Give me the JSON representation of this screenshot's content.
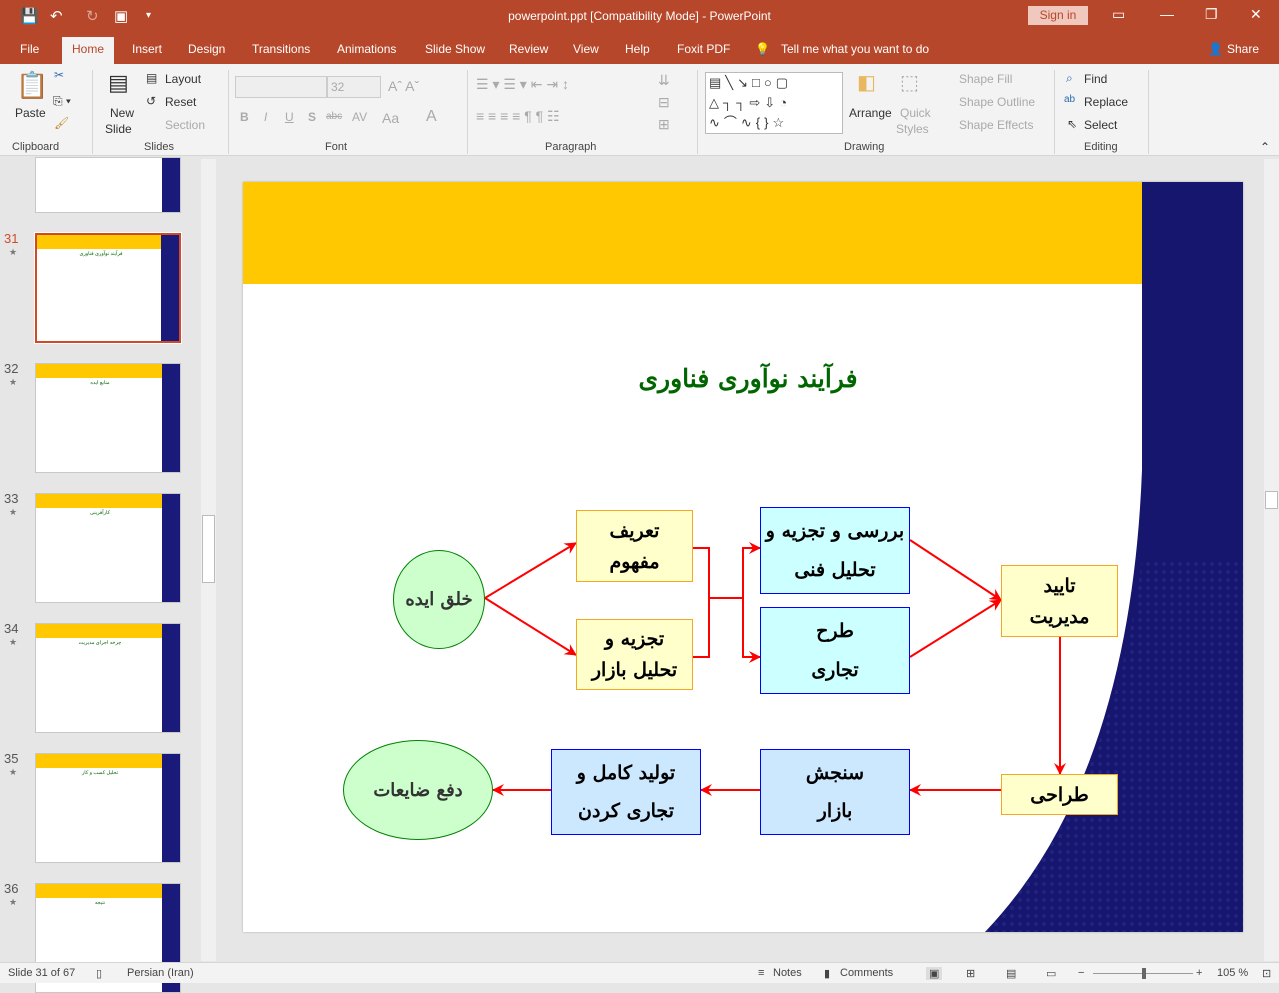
{
  "window": {
    "title": "powerpoint.ppt [Compatibility Mode]  -  PowerPoint",
    "sign_in": "Sign in"
  },
  "tabs": [
    "File",
    "Home",
    "Insert",
    "Design",
    "Transitions",
    "Animations",
    "Slide Show",
    "Review",
    "View",
    "Help",
    "Foxit PDF"
  ],
  "tell_me": "Tell me what you want to do",
  "share": "Share",
  "ribbon": {
    "clipboard": {
      "paste": "Paste",
      "label": "Clipboard"
    },
    "slides": {
      "new_slide_1": "New",
      "new_slide_2": "Slide",
      "layout": "Layout",
      "reset": "Reset",
      "section": "Section",
      "label": "Slides"
    },
    "font": {
      "font_name": "",
      "font_size": "32",
      "bold": "B",
      "italic": "I",
      "underline": "U",
      "shadow": "S",
      "strike": "abc",
      "spacing": "AV",
      "case": "Aa",
      "color": "A",
      "label": "Font"
    },
    "paragraph": {
      "label": "Paragraph"
    },
    "drawing": {
      "arrange": "Arrange",
      "quick_1": "Quick",
      "quick_2": "Styles",
      "shape_fill": "Shape Fill",
      "shape_outline": "Shape Outline",
      "shape_effects": "Shape Effects",
      "label": "Drawing"
    },
    "editing": {
      "find": "Find",
      "replace": "Replace",
      "select": "Select",
      "label": "Editing"
    }
  },
  "thumbnails": [
    {
      "num": "",
      "title": ""
    },
    {
      "num": "31",
      "title": "فرآیند نوآوری فناوری",
      "selected": true
    },
    {
      "num": "32",
      "title": "منابع ایده"
    },
    {
      "num": "33",
      "title": "کارآفرینی"
    },
    {
      "num": "34",
      "title": "چرخه اجرای مدیریت"
    },
    {
      "num": "35",
      "title": "تحلیل کسب و کار"
    },
    {
      "num": "36",
      "title": "نتیجه"
    }
  ],
  "slide": {
    "title": "فرآیند نوآوری فناوری",
    "nodes": {
      "idea": "خلق ایده",
      "concept": [
        "تعریف",
        "مفهوم"
      ],
      "market_analysis": [
        "تجزیه و",
        "تحلیل بازار"
      ],
      "technical": [
        "بررسی و تجزیه و",
        "تحلیل فنی"
      ],
      "business_plan": [
        "طرح",
        "تجاری"
      ],
      "approval": [
        "تایید",
        "مدیریت"
      ],
      "design": "طراحی",
      "market_test": [
        "سنجش",
        "بازار"
      ],
      "production": [
        "تولید کامل و",
        "تجاری کردن"
      ],
      "disposal": "دفع ضایعات"
    },
    "colors": {
      "band": "#ffc800",
      "navy": "#1a1a7a",
      "title": "#006600",
      "arrow": "#ff0000"
    }
  },
  "status": {
    "slide": "Slide 31 of 67",
    "language": "Persian (Iran)",
    "notes": "Notes",
    "comments": "Comments",
    "zoom": "105 %",
    "zoom_percent": 105
  }
}
